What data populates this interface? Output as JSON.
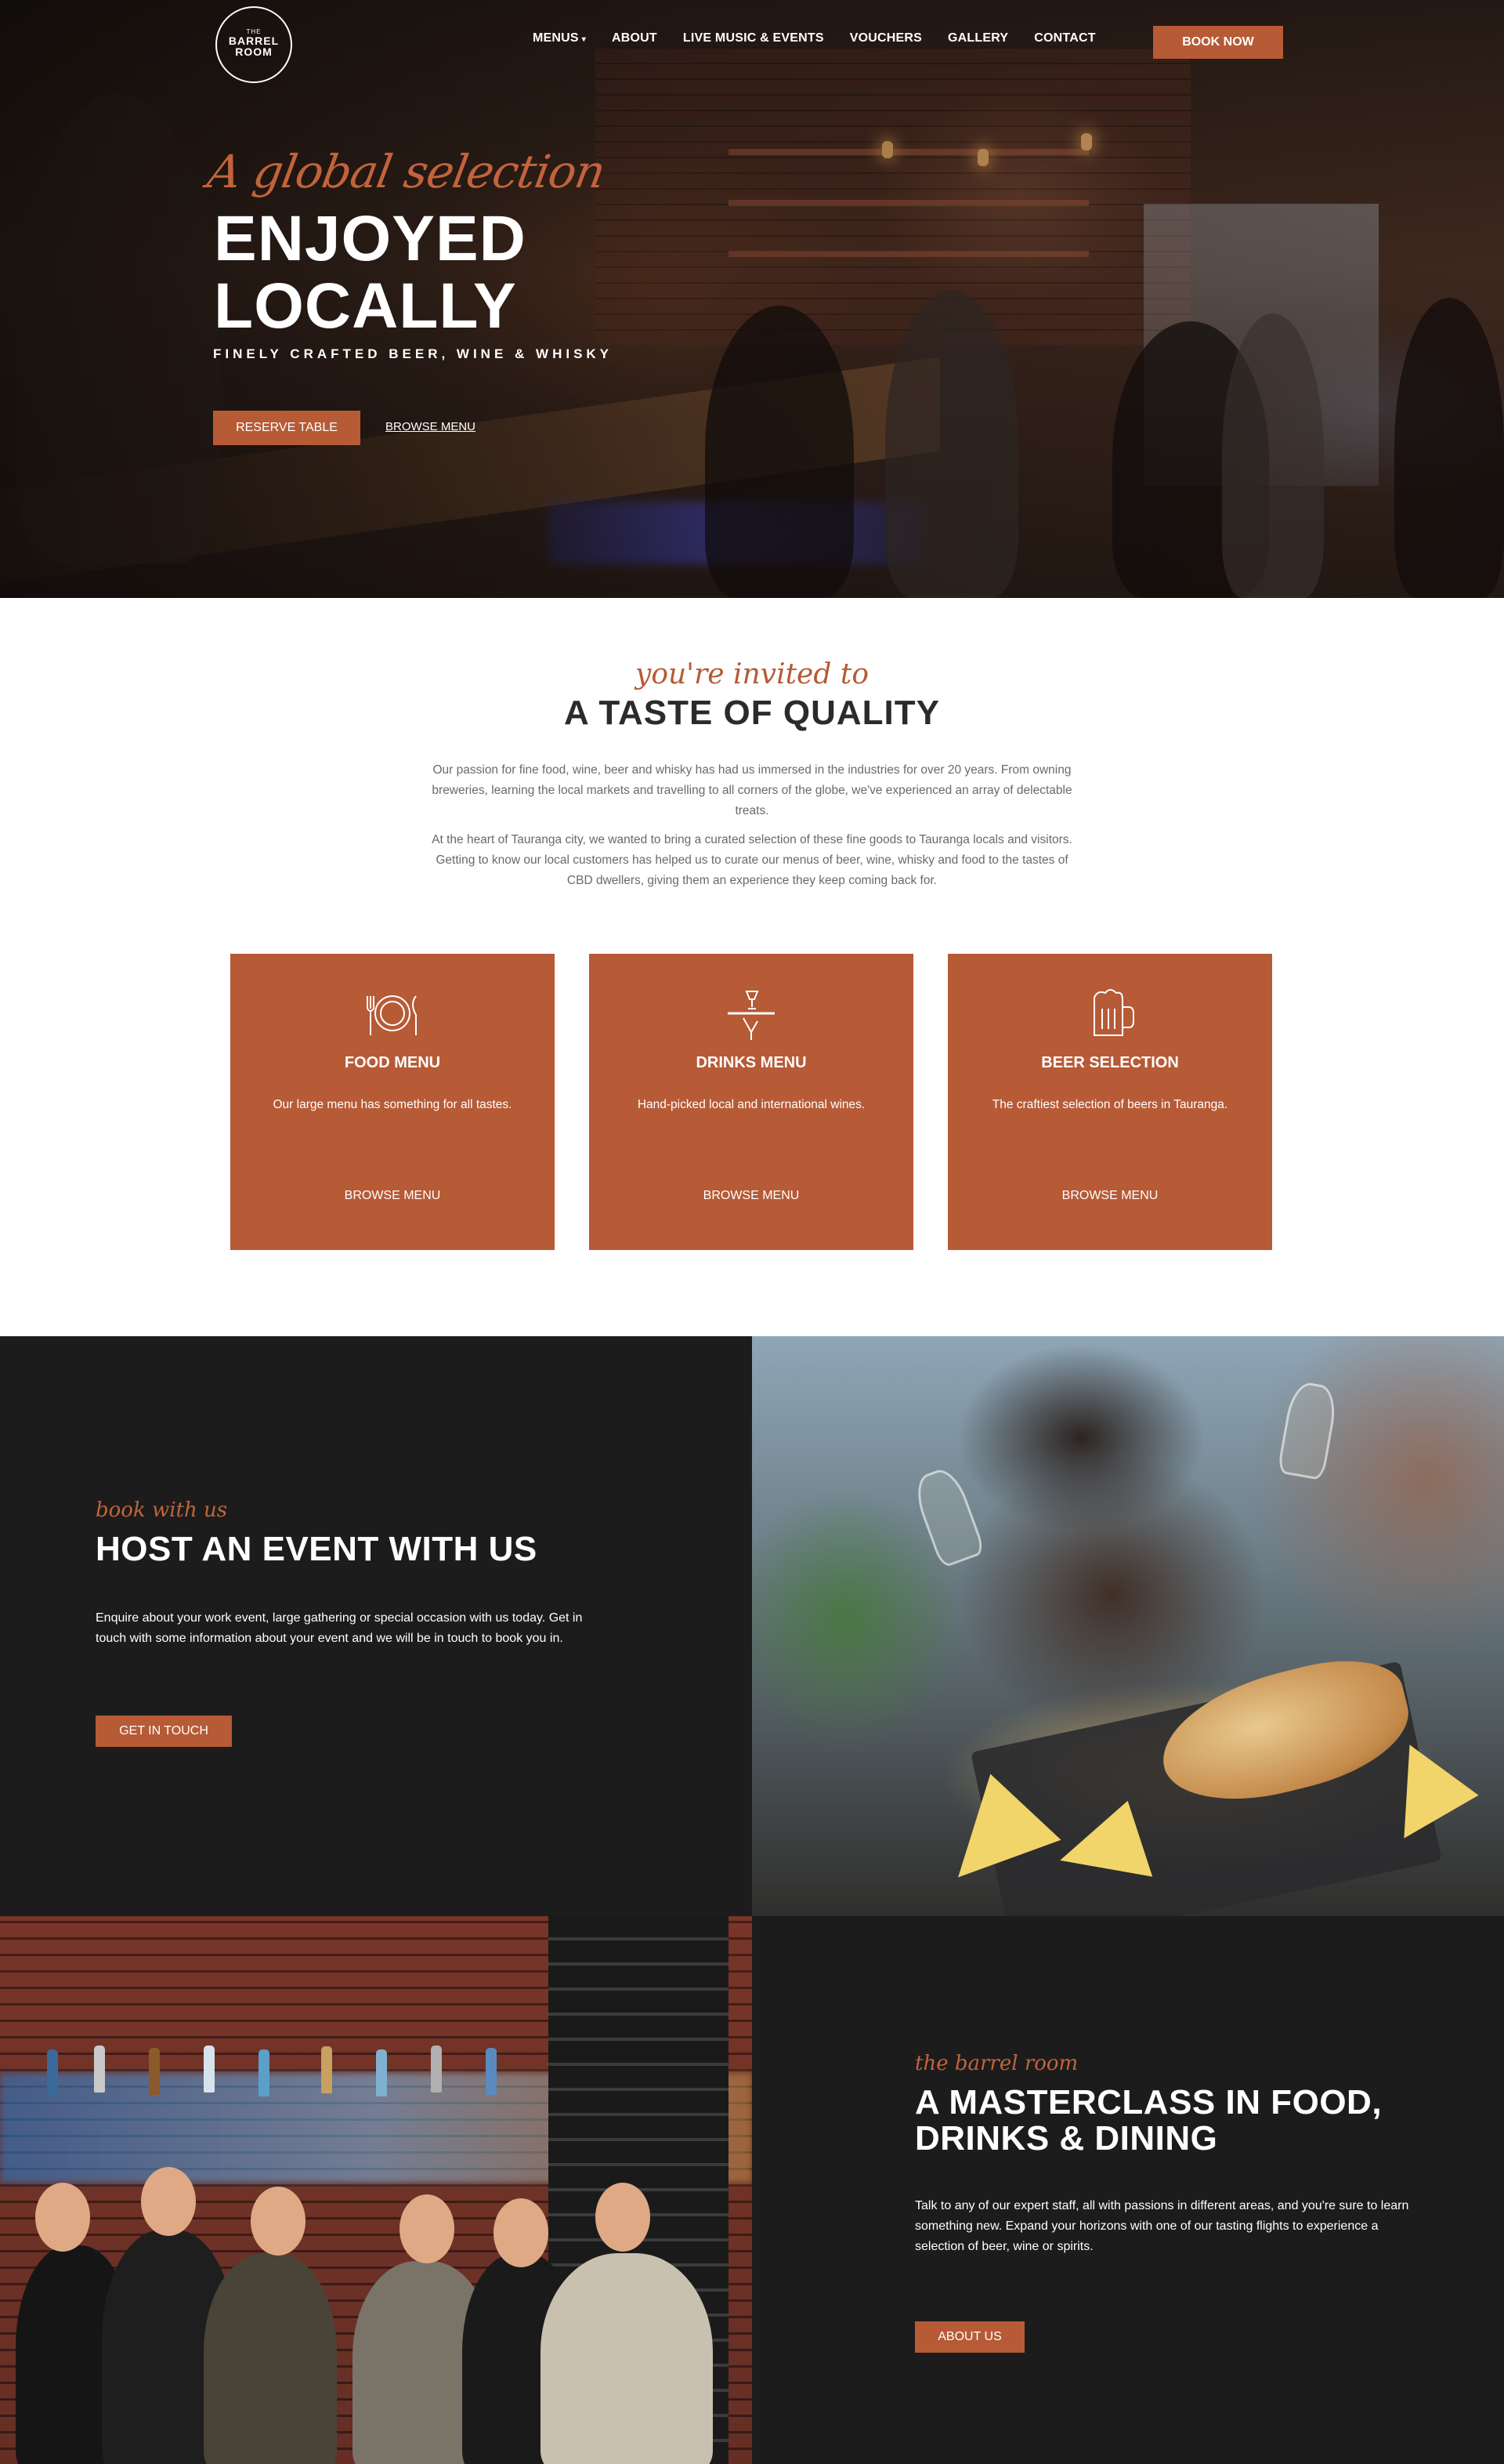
{
  "logo": {
    "the": "THE",
    "line1": "BARREL",
    "line2": "ROOM"
  },
  "nav": {
    "items": [
      "MENUS",
      "ABOUT",
      "LIVE MUSIC & EVENTS",
      "VOUCHERS",
      "GALLERY",
      "CONTACT"
    ],
    "menus_caret": "▾",
    "book": "BOOK NOW"
  },
  "hero": {
    "script": "A global selection",
    "title_line1": "ENJOYED",
    "title_line2": "LOCALLY",
    "subtitle": "FINELY CRAFTED BEER, WINE & WHISKY",
    "reserve": "RESERVE TABLE",
    "browse": "BROWSE MENU"
  },
  "quality": {
    "script": "you're invited to",
    "title": "A TASTE OF QUALITY",
    "p1": "Our passion for fine food, wine, beer and whisky has had us immersed in the industries for over 20 years. From owning breweries, learning the local markets and travelling to all corners of the globe, we've experienced an array of delectable treats.",
    "p2": "At the heart of Tauranga city, we wanted to bring a curated selection of these fine goods to Tauranga locals and visitors. Getting to know our local customers has helped us to curate our menus of beer, wine, whisky and food to the tastes of CBD dwellers, giving them an experience they keep coming back for."
  },
  "cards": [
    {
      "title": "FOOD MENU",
      "desc": "Our large menu has something for all tastes.",
      "link": "BROWSE MENU",
      "icon": "plate-cutlery-icon"
    },
    {
      "title": "DRINKS MENU",
      "desc": "Hand-picked local and international wines.",
      "link": "BROWSE MENU",
      "icon": "waiter-tray-icon"
    },
    {
      "title": "BEER SELECTION",
      "desc": "The craftiest selection of beers in Tauranga.",
      "link": "BROWSE MENU",
      "icon": "beer-mug-icon"
    }
  ],
  "event": {
    "script": "book with us",
    "title": "HOST AN EVENT WITH US",
    "para": "Enquire about your work event, large gathering or special occasion with us today. Get in touch with some information about your event and we will be in touch to book you in.",
    "button": "GET IN TOUCH"
  },
  "masterclass": {
    "script": "the barrel room",
    "title_line1": "A MASTERCLASS IN FOOD,",
    "title_line2": "DRINKS & DINING",
    "para": "Talk to any of our expert staff, all with passions in different areas, and you're sure to learn something new. Expand your horizons with one of our tasting flights to experience a selection of beer, wine or spirits.",
    "button": "ABOUT US"
  },
  "colors": {
    "accent": "#b75a36",
    "dark": "#1c1c1c"
  }
}
